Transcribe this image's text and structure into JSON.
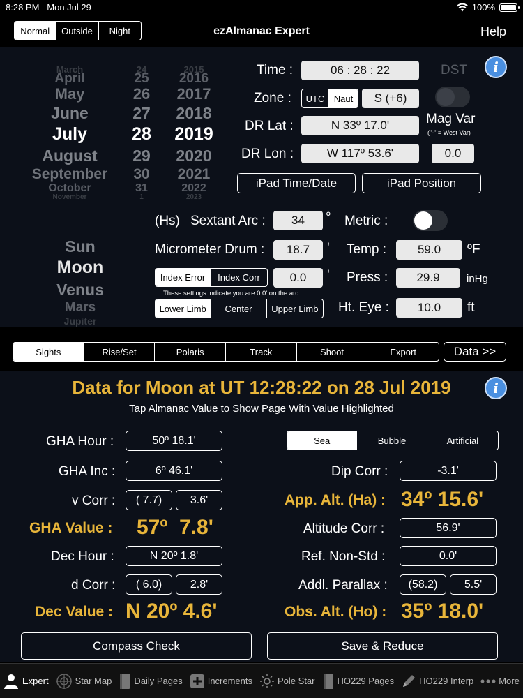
{
  "status": {
    "time": "8:28 PM",
    "date": "Mon Jul 29",
    "battery": "100%"
  },
  "nav": {
    "modes": [
      "Normal",
      "Outside",
      "Night"
    ],
    "active_mode": 0,
    "title": "ezAlmanac Expert",
    "help": "Help"
  },
  "picker": {
    "months": [
      "March",
      "April",
      "May",
      "June",
      "July",
      "August",
      "September",
      "October",
      "November"
    ],
    "days": [
      "24",
      "25",
      "26",
      "27",
      "28",
      "29",
      "30",
      "31",
      "1"
    ],
    "years": [
      "2015",
      "2016",
      "2017",
      "2018",
      "2019",
      "2020",
      "2021",
      "2022",
      "2023"
    ],
    "selected_index": 4,
    "bodies": [
      "Sun",
      "Moon",
      "Venus",
      "Mars",
      "Jupiter"
    ],
    "selected_body": 1
  },
  "time_panel": {
    "time_label": "Time :",
    "time_value": "06 : 28 : 22",
    "dst_label": "DST",
    "zone_label": "Zone :",
    "zone_options": [
      "UTC",
      "Naut"
    ],
    "zone_active": 1,
    "zone_value": "S (+6)",
    "drlat_label": "DR Lat :",
    "drlat_value": "N 33º 17.0'",
    "magvar_label": "Mag Var",
    "magvar_note": "(\"-\" = West Var)",
    "drlon_label": "DR Lon :",
    "drlon_value": "W 117º 53.6'",
    "magvar_value": "0.0",
    "ipad_time_btn": "iPad Time/Date",
    "ipad_pos_btn": "iPad Position"
  },
  "sextant": {
    "hs_label": "(Hs)",
    "arc_label": "Sextant Arc :",
    "arc_value": "34",
    "deg_symbol": "°",
    "metric_label": "Metric :",
    "drum_label": "Micrometer Drum :",
    "drum_value": "18.7",
    "min_symbol": "'",
    "temp_label": "Temp :",
    "temp_value": "59.0",
    "temp_unit": "ºF",
    "index_options": [
      "Index Error",
      "Index Corr"
    ],
    "index_active": 0,
    "index_value": "0.0",
    "index_note": "These settings indicate you are 0.0' on the arc",
    "press_label": "Press :",
    "press_value": "29.9",
    "press_unit": "inHg",
    "limb_options": [
      "Lower Limb",
      "Center",
      "Upper Limb"
    ],
    "limb_active": 0,
    "hteye_label": "Ht. Eye :",
    "hteye_value": "10.0",
    "hteye_unit": "ft"
  },
  "tabs": {
    "items": [
      "Sights",
      "Rise/Set",
      "Polaris",
      "Track",
      "Shoot",
      "Export"
    ],
    "active": 0,
    "data_btn": "Data >>"
  },
  "results": {
    "header": "Data for Moon at UT 12:28:22 on 28 Jul 2019",
    "subheader": "Tap Almanac Value to Show Page With Value Highlighted",
    "gha_hour_label": "GHA Hour :",
    "gha_hour_value": "50º 18.1'",
    "gha_inc_label": "GHA Inc :",
    "gha_inc_value": "6º 46.1'",
    "v_corr_label": "v Corr :",
    "v_corr_a": "( 7.7)",
    "v_corr_b": "3.6'",
    "gha_value_label": "GHA Value :",
    "gha_value": "57º  7.8'",
    "dec_hour_label": "Dec Hour :",
    "dec_hour_value": "N 20º 1.8'",
    "d_corr_label": "d Corr :",
    "d_corr_a": "( 6.0)",
    "d_corr_b": "2.8'",
    "dec_value_label": "Dec Value :",
    "dec_value": "N 20º 4.6'",
    "horizon_options": [
      "Sea",
      "Bubble",
      "Artificial"
    ],
    "horizon_active": 0,
    "dip_label": "Dip Corr :",
    "dip_value": "-3.1'",
    "app_alt_label": "App. Alt. (Ha) :",
    "app_alt_value": "34º 15.6'",
    "alt_corr_label": "Altitude Corr :",
    "alt_corr_value": "56.9'",
    "ref_label": "Ref. Non-Std :",
    "ref_value": "0.0'",
    "addl_label": "Addl. Parallax :",
    "addl_a": "(58.2)",
    "addl_b": "5.5'",
    "obs_alt_label": "Obs. Alt. (Ho) :",
    "obs_alt_value": "35º 18.0'",
    "compass_btn": "Compass Check",
    "save_btn": "Save & Reduce"
  },
  "bottom": {
    "items": [
      "Expert",
      "Star Map",
      "Daily Pages",
      "Increments",
      "Pole Star",
      "HO229 Pages",
      "HO229 Interp",
      "More"
    ],
    "icons": [
      "person-icon",
      "crosshair-icon",
      "book-icon",
      "plus-icon",
      "sun-icon",
      "book-icon",
      "pencil-icon",
      "more-icon"
    ],
    "active": 0
  },
  "colors": {
    "accent_gold": "#e8b53a",
    "panel_bg": "#0c1019",
    "info_blue": "#4a8fe0",
    "field_bg": "#e9e9e9"
  }
}
